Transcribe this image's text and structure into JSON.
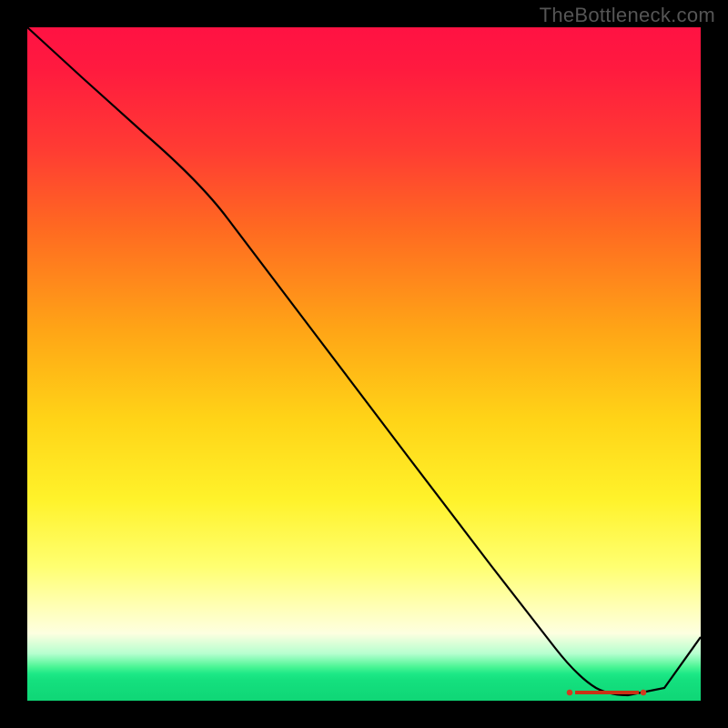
{
  "watermark": "TheBottleneck.com",
  "chart_data": {
    "type": "line",
    "title": "",
    "xlabel": "",
    "ylabel": "",
    "x": [
      0.0,
      0.1,
      0.2,
      0.3,
      0.4,
      0.5,
      0.6,
      0.7,
      0.78,
      0.84,
      0.88,
      0.92,
      1.0
    ],
    "values": [
      1.0,
      0.92,
      0.84,
      0.74,
      0.6,
      0.46,
      0.32,
      0.18,
      0.06,
      0.01,
      0.0,
      0.01,
      0.12
    ],
    "xlim": [
      0,
      1
    ],
    "ylim": [
      0,
      1
    ],
    "annotations": [
      {
        "text": "",
        "x": 0.85,
        "y": 0.005
      }
    ],
    "background_gradient": {
      "orientation": "vertical",
      "stops": [
        {
          "pos": 0.0,
          "color": "#ff1243"
        },
        {
          "pos": 0.3,
          "color": "#ff6a21"
        },
        {
          "pos": 0.6,
          "color": "#ffd317"
        },
        {
          "pos": 0.85,
          "color": "#ffffb5"
        },
        {
          "pos": 0.95,
          "color": "#49f594"
        },
        {
          "pos": 1.0,
          "color": "#0fd676"
        }
      ]
    }
  }
}
